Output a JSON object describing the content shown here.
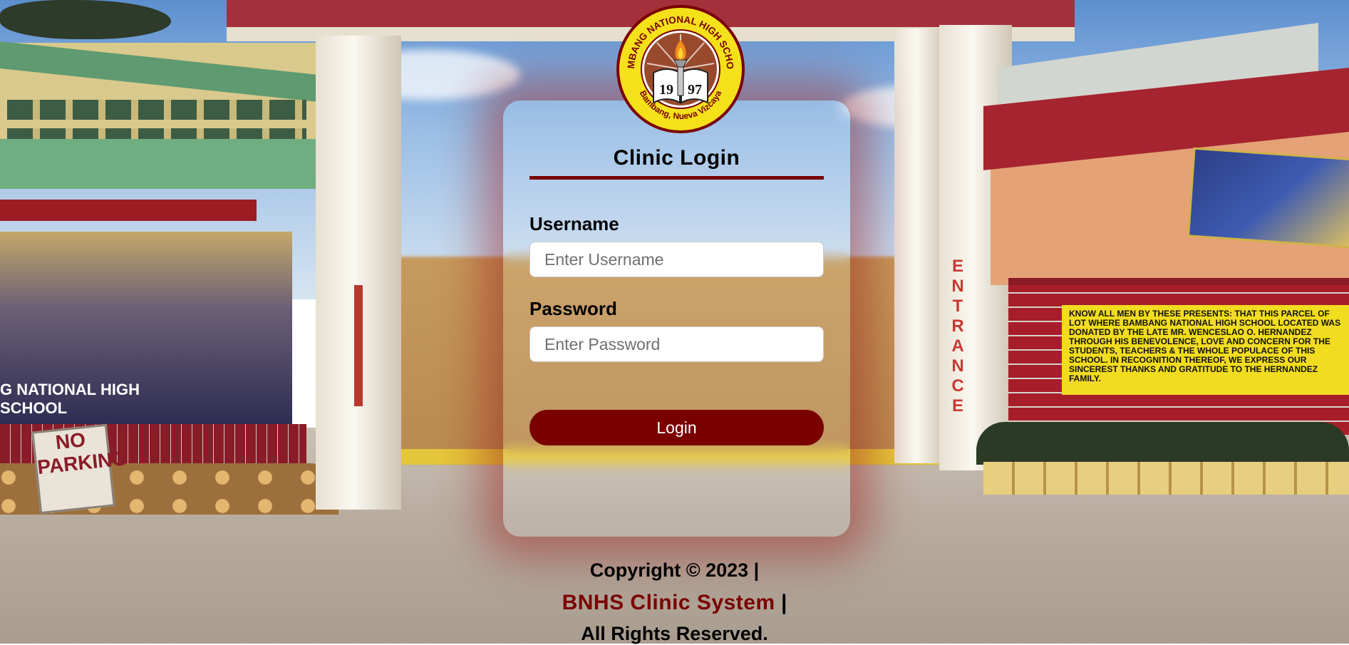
{
  "background": {
    "banner_text": "G NATIONAL HIGH SCHOOL",
    "no_parking_sign": "NO PARKING",
    "gate_side_text": "ENTRANCE",
    "plaque_text": "KNOW ALL MEN BY THESE PRESENTS: THAT THIS PARCEL OF LOT WHERE BAMBANG NATIONAL HIGH SCHOOL LOCATED WAS DONATED BY THE LATE MR. WENCESLAO O. HERNANDEZ THROUGH HIS BENEVOLENCE, LOVE AND CONCERN FOR THE STUDENTS, TEACHERS & THE WHOLE POPULACE OF THIS SCHOOL. IN RECOGNITION THEREOF, WE EXPRESS OUR SINCEREST THANKS AND GRATITUDE TO THE HERNANDEZ FAMILY."
  },
  "seal": {
    "top_text": "BAMBANG NATIONAL HIGH SCHOOL",
    "bottom_text": "Bambang, Nueva Vizcaya",
    "year_left": "19",
    "year_right": "97",
    "colors": {
      "ring": "#f4e11a",
      "inner": "#9a4a2c",
      "border": "#7a0000"
    }
  },
  "login": {
    "title": "Clinic Login",
    "username_label": "Username",
    "username_placeholder": "Enter Username",
    "username_value": "",
    "password_label": "Password",
    "password_placeholder": "Enter Password",
    "password_value": "",
    "button_label": "Login"
  },
  "footer": {
    "copyright": "Copyright © 2023 |",
    "system_name": "BNHS Clinic System",
    "separator": "|",
    "rights": "All Rights Reserved."
  },
  "colors": {
    "accent": "#7a0000",
    "title_rule": "#7a0000",
    "button_bg": "#7a0000",
    "button_text": "#ffffff"
  }
}
